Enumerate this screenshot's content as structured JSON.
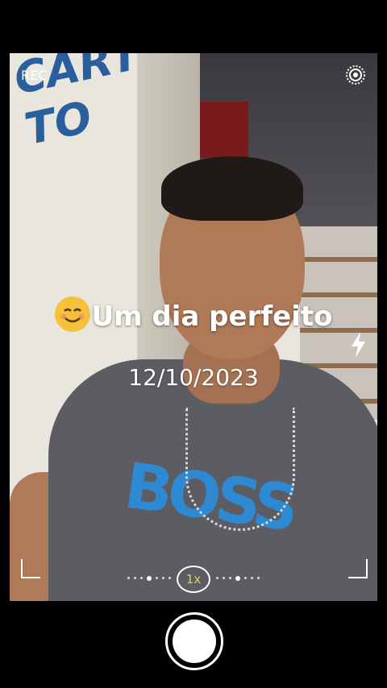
{
  "status": {
    "rec_label": "REC"
  },
  "overlay": {
    "caption": "Um dia perfeito",
    "date": "12/10/2023"
  },
  "zoom": {
    "label": "1x"
  },
  "background": {
    "wall_text": "CARTÕES\nTO"
  },
  "icons": {
    "settings": "target-settings-icon",
    "flash": "lightning-flash-icon",
    "emoji": "smiling-face-icon"
  },
  "colors": {
    "zoom_accent": "#f2c94c",
    "frame": "#000000"
  }
}
